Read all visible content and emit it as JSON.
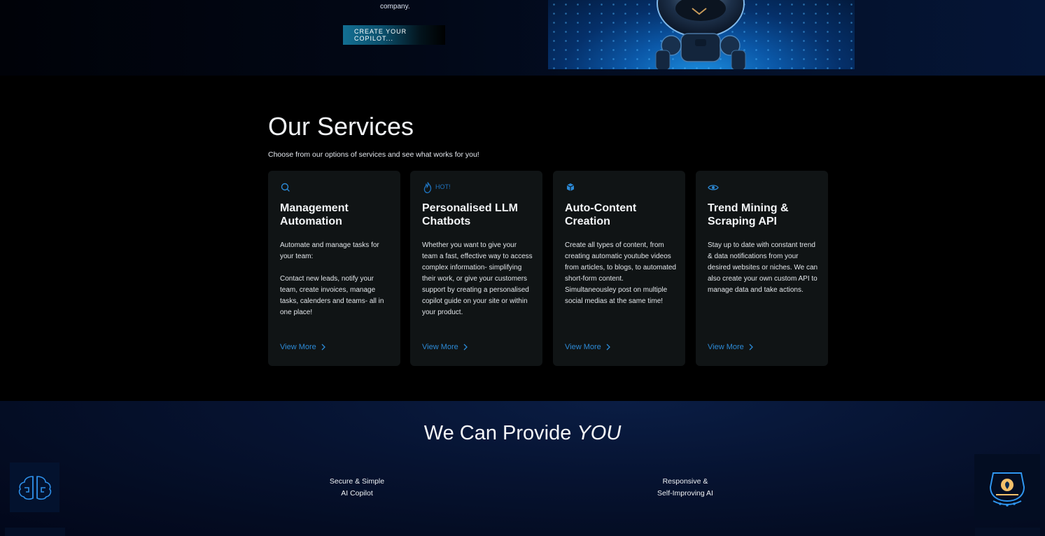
{
  "hero": {
    "text": "company.",
    "cta_label": "CREATE YOUR COPILOT..."
  },
  "services": {
    "title": "Our Services",
    "subtitle": "Choose from our options of services and see what works for you!",
    "view_more_label": "View More",
    "cards": [
      {
        "icon": "search-icon",
        "title": "Management Automation",
        "description": "Automate and manage tasks for your team:\n\nContact new leads, notify your team, create invoices, manage tasks, calenders and teams- all in one place!",
        "link": "View More"
      },
      {
        "icon": "flame-icon",
        "badge": "HOT!",
        "title": "Personalised LLM Chatbots",
        "description": "Whether you want to give your team a fast, effective way to access complex information- simplifying their work, or give your customers support by creating a personalised copilot guide on your site or within your product.",
        "link": "View More"
      },
      {
        "icon": "cube-icon",
        "title": "Auto-Content Creation",
        "description": "Create all types of content, from creating automatic youtube videos from articles, to blogs, to automated short-form content. Simultaneousley post on multiple social medias at the same time!",
        "link": "View More"
      },
      {
        "icon": "eye-icon",
        "title": "Trend Mining & Scraping API",
        "description": "Stay up to date with constant trend & data notifications from your desired websites or niches. We can also create your own custom API to manage data and take actions.",
        "link": "View More"
      }
    ]
  },
  "provide": {
    "title_prefix": "We Can Provide",
    "title_emphasis": "YOU",
    "features": [
      "Secure & Simple\nAI Copilot",
      "Responsive &\nSelf-Improving AI"
    ]
  },
  "colors": {
    "accent": "#2c8ad6",
    "card_bg": "#101415",
    "hot_badge": "#1f74c0"
  }
}
